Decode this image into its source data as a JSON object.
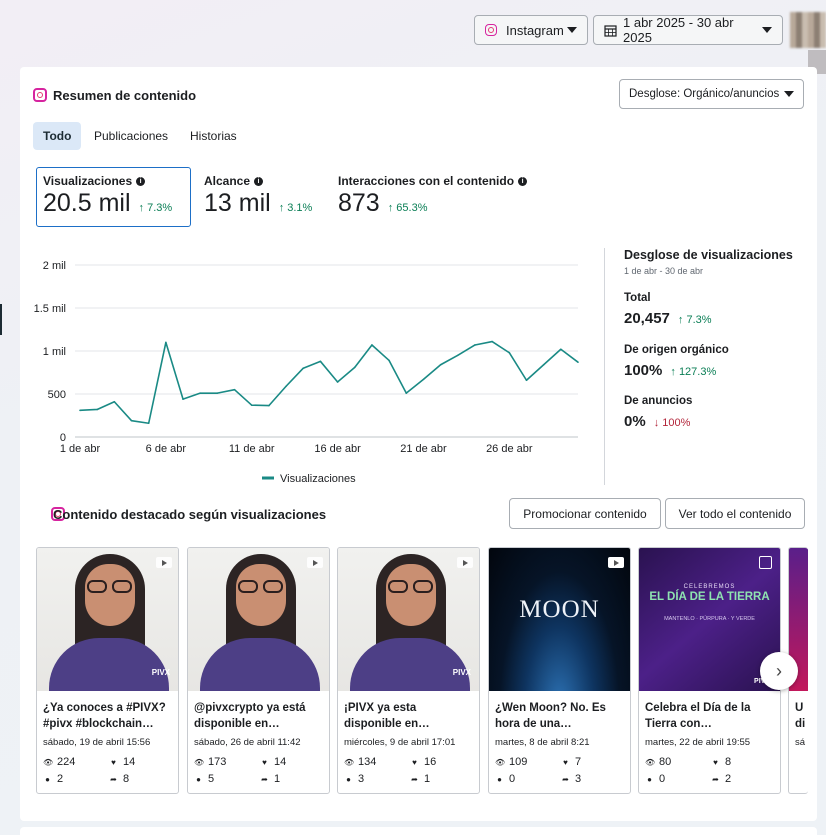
{
  "topbar": {
    "platform_label": "Instagram",
    "date_range_label": "1 abr 2025 - 30 abr 2025"
  },
  "content_summary": {
    "title": "Resumen de contenido",
    "breakdown_dropdown": "Desglose: Orgánico/anuncios",
    "tabs": [
      {
        "label": "Todo",
        "active": true
      },
      {
        "label": "Publicaciones",
        "active": false
      },
      {
        "label": "Historias",
        "active": false
      }
    ],
    "metrics": [
      {
        "label": "Visualizaciones",
        "value": "20.5 mil",
        "delta": "7.3%",
        "direction": "up",
        "selected": true
      },
      {
        "label": "Alcance",
        "value": "13 mil",
        "delta": "3.1%",
        "direction": "up",
        "selected": false
      },
      {
        "label": "Interacciones con el contenido",
        "value": "873",
        "delta": "65.3%",
        "direction": "up",
        "selected": false
      }
    ]
  },
  "chart_data": {
    "type": "line",
    "series": [
      {
        "name": "Visualizaciones",
        "color": "#1a8a85",
        "values": [
          310,
          320,
          410,
          190,
          160,
          1100,
          440,
          510,
          510,
          550,
          370,
          365,
          590,
          800,
          880,
          640,
          810,
          1070,
          890,
          510,
          670,
          840,
          950,
          1070,
          1110,
          980,
          660,
          840,
          1020,
          870
        ]
      }
    ],
    "x": [
      1,
      2,
      3,
      4,
      5,
      6,
      7,
      8,
      9,
      10,
      11,
      12,
      13,
      14,
      15,
      16,
      17,
      18,
      19,
      20,
      21,
      22,
      23,
      24,
      25,
      26,
      27,
      28,
      29,
      30
    ],
    "x_tick_labels": [
      {
        "x": 1,
        "label": "1 de abr"
      },
      {
        "x": 6,
        "label": "6 de abr"
      },
      {
        "x": 11,
        "label": "11 de abr"
      },
      {
        "x": 16,
        "label": "16 de abr"
      },
      {
        "x": 21,
        "label": "21 de abr"
      },
      {
        "x": 26,
        "label": "26 de abr"
      }
    ],
    "y_ticks": [
      {
        "value": 0,
        "label": "0"
      },
      {
        "value": 500,
        "label": "500"
      },
      {
        "value": 1000,
        "label": "1 mil"
      },
      {
        "value": 1500,
        "label": "1.5 mil"
      },
      {
        "value": 2000,
        "label": "2 mil"
      }
    ],
    "ylim": [
      0,
      2000
    ],
    "grid": true,
    "legend": "bottom",
    "legend_label": "Visualizaciones"
  },
  "breakdown": {
    "title": "Desglose de visualizaciones",
    "subtitle": "1 de abr - 30 de abr",
    "items": [
      {
        "label": "Total",
        "value": "20,457",
        "delta": "7.3%",
        "direction": "up"
      },
      {
        "label": "De origen orgánico",
        "value": "100%",
        "delta": "127.3%",
        "direction": "up"
      },
      {
        "label": "De anuncios",
        "value": "0%",
        "delta": "100%",
        "direction": "down"
      }
    ]
  },
  "featured": {
    "title": "Contenido destacado según visualizaciones",
    "promote_button": "Promocionar contenido",
    "view_all_button": "Ver todo el contenido",
    "posts": [
      {
        "title": "¿Ya conoces a #PIVX? #pivx #blockchain…",
        "date": "sábado, 19 de abril 15:56",
        "views": "224",
        "likes": "14",
        "comments": "2",
        "shares": "8",
        "kind": "person"
      },
      {
        "title": "@pivxcrypto ya está disponible en…",
        "date": "sábado, 26 de abril 11:42",
        "views": "173",
        "likes": "14",
        "comments": "5",
        "shares": "1",
        "kind": "person"
      },
      {
        "title": "¡PIVX ya esta disponible en…",
        "date": "miércoles, 9 de abril 17:01",
        "views": "134",
        "likes": "16",
        "comments": "3",
        "shares": "1",
        "kind": "person"
      },
      {
        "title": "¿Wen Moon? No. Es hora de una…",
        "date": "martes, 8 de abril 8:21",
        "views": "109",
        "likes": "7",
        "comments": "0",
        "shares": "3",
        "kind": "moon",
        "overlay_text": "MOON"
      },
      {
        "title": "Celebra el Día de la Tierra con…",
        "date": "martes, 22 de abril 19:55",
        "views": "80",
        "likes": "8",
        "comments": "0",
        "shares": "2",
        "kind": "earth",
        "overlay_small": "CELEBREMOS",
        "overlay_text": "EL DÍA DE LA TIERRA",
        "overlay_sub": "MANTENLO · PÚRPURA · Y VERDE",
        "brand": "PIVX"
      },
      {
        "title": "U di",
        "date": "sá",
        "kind": "partial"
      }
    ]
  }
}
